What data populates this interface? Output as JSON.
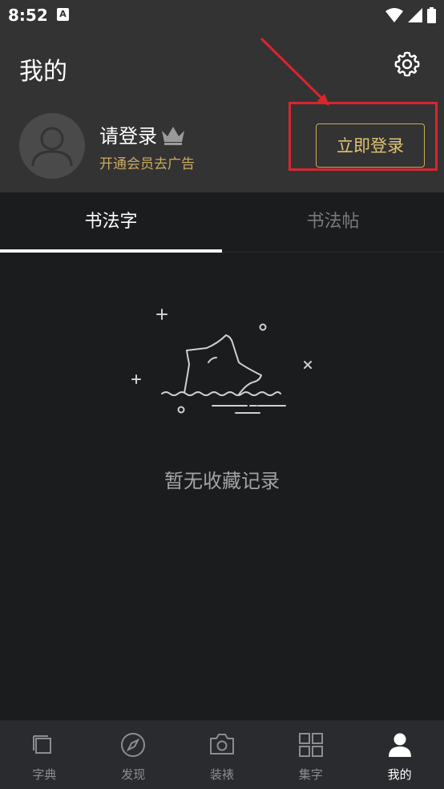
{
  "status_bar": {
    "time": "8:52",
    "notification_glyph": "A",
    "icons": [
      "wifi-icon",
      "signal-icon",
      "battery-icon"
    ]
  },
  "header": {
    "title": "我的",
    "settings_icon": "gear-icon",
    "login_prompt": "请登录",
    "vip_icon": "crown-icon",
    "vip_hint": "开通会员去广告",
    "login_button": "立即登录"
  },
  "tabs": [
    {
      "label": "书法字",
      "active": true
    },
    {
      "label": "书法帖",
      "active": false
    }
  ],
  "empty_state": {
    "icon": "empty-star-icon",
    "message": "暂无收藏记录"
  },
  "bottom_nav": [
    {
      "label": "字典",
      "icon": "dictionary-icon",
      "active": false
    },
    {
      "label": "发现",
      "icon": "compass-icon",
      "active": false
    },
    {
      "label": "装裱",
      "icon": "camera-icon",
      "active": false
    },
    {
      "label": "集字",
      "icon": "grid-icon",
      "active": false
    },
    {
      "label": "我的",
      "icon": "person-icon",
      "active": true
    }
  ],
  "colors": {
    "accent_gold": "#c9a95f",
    "highlight_red": "#d8262f",
    "header_bg": "#333333",
    "page_bg": "#1b1c1e"
  }
}
